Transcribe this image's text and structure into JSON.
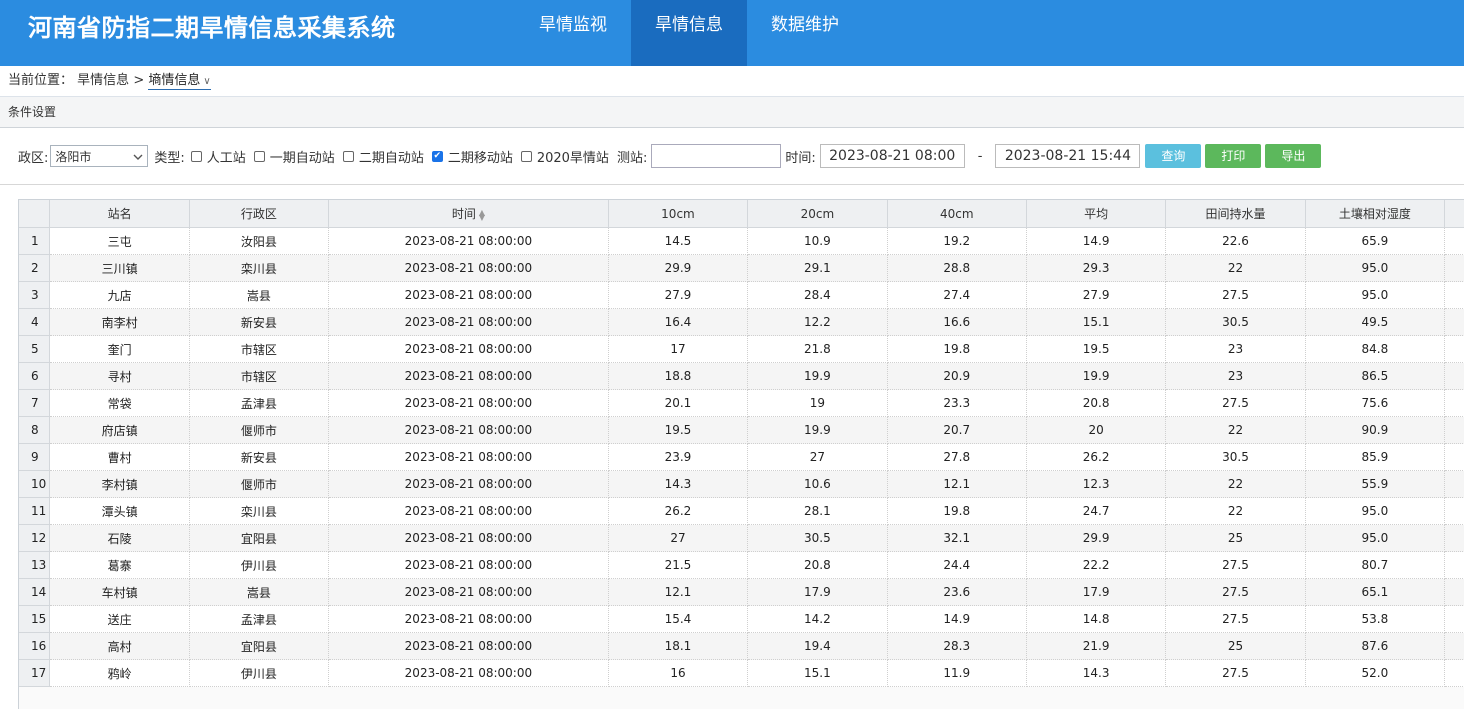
{
  "header": {
    "title": "河南省防指二期旱情信息采集系统",
    "nav": [
      {
        "label": "旱情监视",
        "active": false
      },
      {
        "label": "旱情信息",
        "active": true
      },
      {
        "label": "数据维护",
        "active": false
      }
    ],
    "bg_color": "#2b8ce0",
    "active_color": "#1a6cbf"
  },
  "breadcrumb": {
    "prefix": "当前位置：",
    "level1": "旱情信息",
    "sep": ">",
    "current": "墒情信息",
    "caret": "∨"
  },
  "condition_bar": {
    "label": "条件设置"
  },
  "filter": {
    "region_label": "政区:",
    "region_value": "洛阳市",
    "type_label": "类型:",
    "types": [
      {
        "label": "人工站",
        "checked": false
      },
      {
        "label": "一期自动站",
        "checked": false
      },
      {
        "label": "二期自动站",
        "checked": false
      },
      {
        "label": "二期移动站",
        "checked": true
      },
      {
        "label": "2020旱情站",
        "checked": false
      }
    ],
    "station_label": "测站:",
    "station_value": "",
    "time_label": "时间:",
    "time_start": "2023-08-21 08:00",
    "time_sep": "-",
    "time_end": "2023-08-21 15:44",
    "buttons": {
      "query": "查询",
      "print": "打印",
      "export": "导出"
    },
    "button_colors": {
      "query": "#5bc0de",
      "print": "#5cb85c",
      "export": "#5cb85c"
    }
  },
  "table": {
    "columns": [
      "站名",
      "行政区",
      "时间",
      "10cm",
      "20cm",
      "40cm",
      "平均",
      "田间持水量",
      "土壤相对湿度"
    ],
    "rows": [
      [
        "1",
        "三屯",
        "汝阳县",
        "2023-08-21 08:00:00",
        "14.5",
        "10.9",
        "19.2",
        "14.9",
        "22.6",
        "65.9"
      ],
      [
        "2",
        "三川镇",
        "栾川县",
        "2023-08-21 08:00:00",
        "29.9",
        "29.1",
        "28.8",
        "29.3",
        "22",
        "95.0"
      ],
      [
        "3",
        "九店",
        "嵩县",
        "2023-08-21 08:00:00",
        "27.9",
        "28.4",
        "27.4",
        "27.9",
        "27.5",
        "95.0"
      ],
      [
        "4",
        "南李村",
        "新安县",
        "2023-08-21 08:00:00",
        "16.4",
        "12.2",
        "16.6",
        "15.1",
        "30.5",
        "49.5"
      ],
      [
        "5",
        "奎门",
        "市辖区",
        "2023-08-21 08:00:00",
        "17",
        "21.8",
        "19.8",
        "19.5",
        "23",
        "84.8"
      ],
      [
        "6",
        "寻村",
        "市辖区",
        "2023-08-21 08:00:00",
        "18.8",
        "19.9",
        "20.9",
        "19.9",
        "23",
        "86.5"
      ],
      [
        "7",
        "常袋",
        "孟津县",
        "2023-08-21 08:00:00",
        "20.1",
        "19",
        "23.3",
        "20.8",
        "27.5",
        "75.6"
      ],
      [
        "8",
        "府店镇",
        "偃师市",
        "2023-08-21 08:00:00",
        "19.5",
        "19.9",
        "20.7",
        "20",
        "22",
        "90.9"
      ],
      [
        "9",
        "曹村",
        "新安县",
        "2023-08-21 08:00:00",
        "23.9",
        "27",
        "27.8",
        "26.2",
        "30.5",
        "85.9"
      ],
      [
        "10",
        "李村镇",
        "偃师市",
        "2023-08-21 08:00:00",
        "14.3",
        "10.6",
        "12.1",
        "12.3",
        "22",
        "55.9"
      ],
      [
        "11",
        "潭头镇",
        "栾川县",
        "2023-08-21 08:00:00",
        "26.2",
        "28.1",
        "19.8",
        "24.7",
        "22",
        "95.0"
      ],
      [
        "12",
        "石陵",
        "宜阳县",
        "2023-08-21 08:00:00",
        "27",
        "30.5",
        "32.1",
        "29.9",
        "25",
        "95.0"
      ],
      [
        "13",
        "葛寨",
        "伊川县",
        "2023-08-21 08:00:00",
        "21.5",
        "20.8",
        "24.4",
        "22.2",
        "27.5",
        "80.7"
      ],
      [
        "14",
        "车村镇",
        "嵩县",
        "2023-08-21 08:00:00",
        "12.1",
        "17.9",
        "23.6",
        "17.9",
        "27.5",
        "65.1"
      ],
      [
        "15",
        "送庄",
        "孟津县",
        "2023-08-21 08:00:00",
        "15.4",
        "14.2",
        "14.9",
        "14.8",
        "27.5",
        "53.8"
      ],
      [
        "16",
        "高村",
        "宜阳县",
        "2023-08-21 08:00:00",
        "18.1",
        "19.4",
        "28.3",
        "21.9",
        "25",
        "87.6"
      ],
      [
        "17",
        "鸦岭",
        "伊川县",
        "2023-08-21 08:00:00",
        "16",
        "15.1",
        "11.9",
        "14.3",
        "27.5",
        "52.0"
      ]
    ]
  }
}
